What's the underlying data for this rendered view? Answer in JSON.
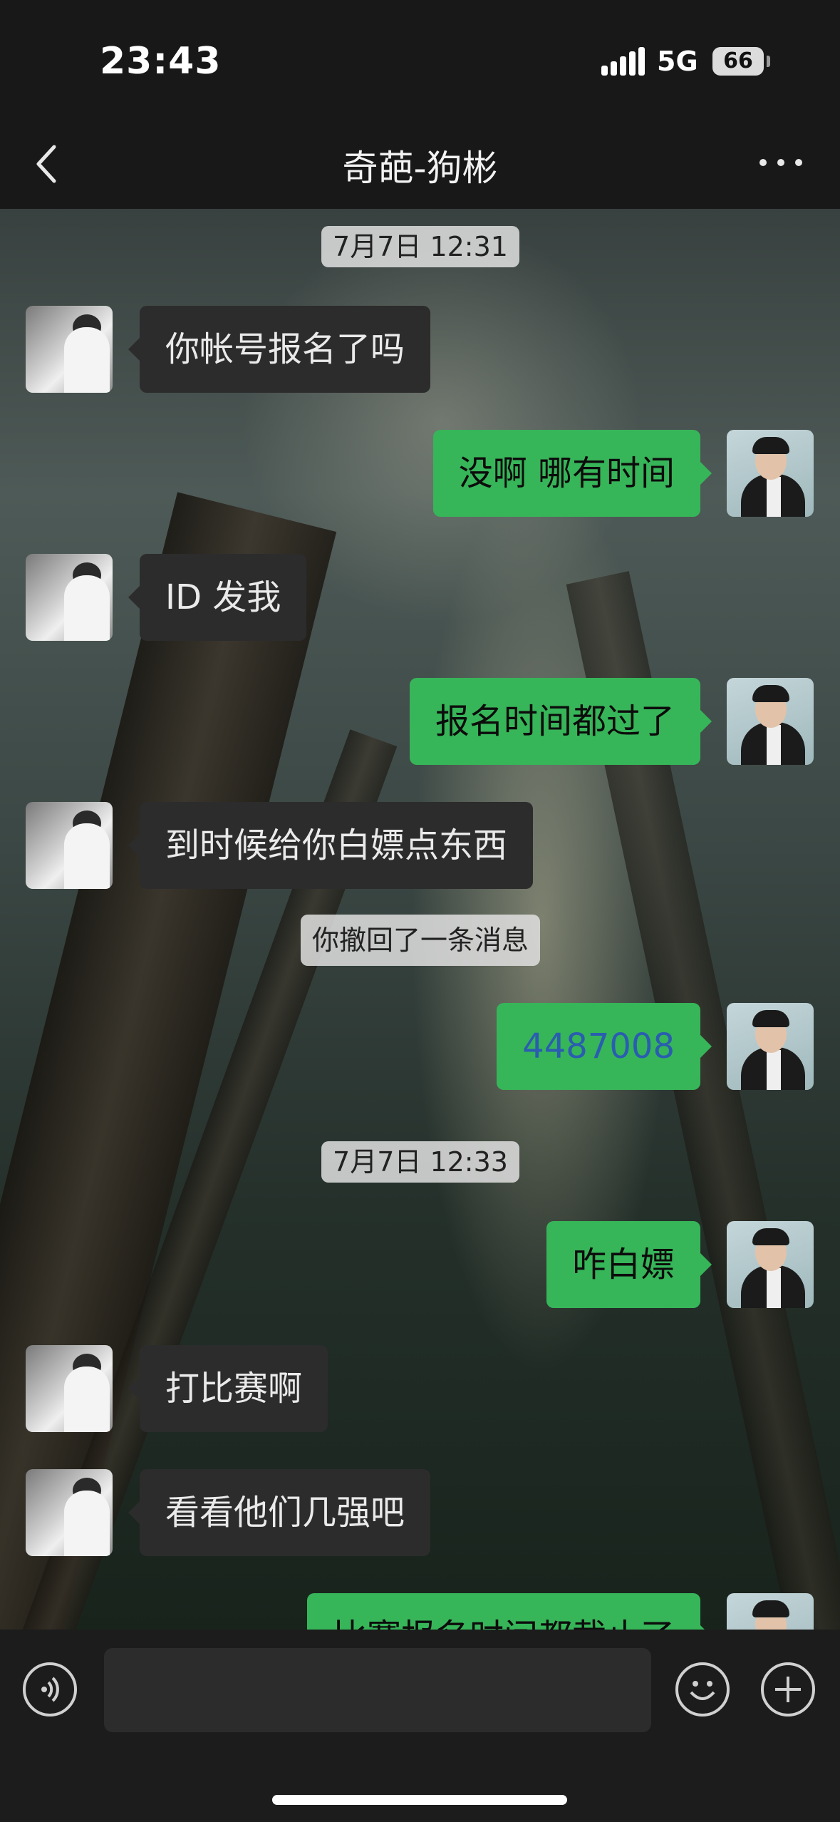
{
  "status_bar": {
    "time": "23:43",
    "network": "5G",
    "battery": "66"
  },
  "nav": {
    "title": "奇葩-狗彬"
  },
  "messages": [
    {
      "type": "timestamp",
      "text": "7月7日 12:31"
    },
    {
      "type": "incoming",
      "text": "你帐号报名了吗"
    },
    {
      "type": "outgoing",
      "text": "没啊 哪有时间"
    },
    {
      "type": "incoming",
      "text": "ID 发我"
    },
    {
      "type": "outgoing",
      "text": "报名时间都过了"
    },
    {
      "type": "incoming",
      "text": "到时候给你白嫖点东西"
    },
    {
      "type": "system",
      "text": "你撤回了一条消息"
    },
    {
      "type": "outgoing",
      "text": "4487008"
    },
    {
      "type": "timestamp",
      "text": "7月7日 12:33"
    },
    {
      "type": "outgoing",
      "text": "咋白嫖"
    },
    {
      "type": "incoming",
      "text": "打比赛啊"
    },
    {
      "type": "incoming",
      "text": "看看他们几强吧"
    },
    {
      "type": "outgoing",
      "text": "比赛报名时间都截止了"
    }
  ],
  "input_bar": {
    "voice_icon": "voice-icon",
    "emoji_icon": "emoji-icon",
    "plus_icon": "plus-icon"
  },
  "colors": {
    "outgoing_bubble": "#37b559",
    "incoming_bubble": "#2c2c2c",
    "link_text": "#2a5db0"
  }
}
